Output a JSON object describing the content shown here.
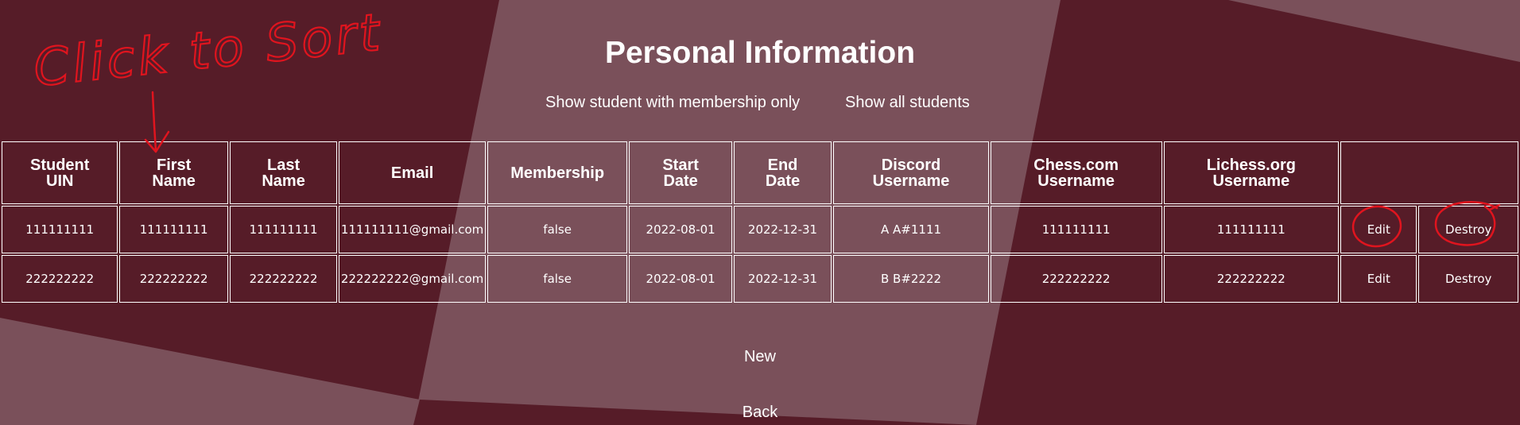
{
  "page": {
    "title": "Personal Information",
    "background_color": "#561c28",
    "accent_overlay_color": "#7a505a",
    "annotation_color": "#e0141e"
  },
  "filters": {
    "membership_only": "Show student with membership only",
    "all_students": "Show all students"
  },
  "table": {
    "columns": [
      "Student\nUIN",
      "First\nName",
      "Last\nName",
      "Email",
      "Membership",
      "Start\nDate",
      "End\nDate",
      "Discord\nUsername",
      "Chess.com\nUsername",
      "Lichess.org\nUsername",
      ""
    ],
    "rows": [
      {
        "uin": "111111111",
        "first_name": "111111111",
        "last_name": "111111111",
        "email": "111111111@gmail.com",
        "membership": "false",
        "start_date": "2022-08-01",
        "end_date": "2022-12-31",
        "discord": "A A#1111",
        "chess_com": "111111111",
        "lichess": "111111111",
        "edit": "Edit",
        "destroy": "Destroy"
      },
      {
        "uin": "222222222",
        "first_name": "222222222",
        "last_name": "222222222",
        "email": "222222222@gmail.com",
        "membership": "false",
        "start_date": "2022-08-01",
        "end_date": "2022-12-31",
        "discord": "B B#2222",
        "chess_com": "222222222",
        "lichess": "222222222",
        "edit": "Edit",
        "destroy": "Destroy"
      }
    ]
  },
  "links": {
    "new": "New",
    "back": "Back"
  },
  "annotation": {
    "text": "Click to Sort"
  }
}
